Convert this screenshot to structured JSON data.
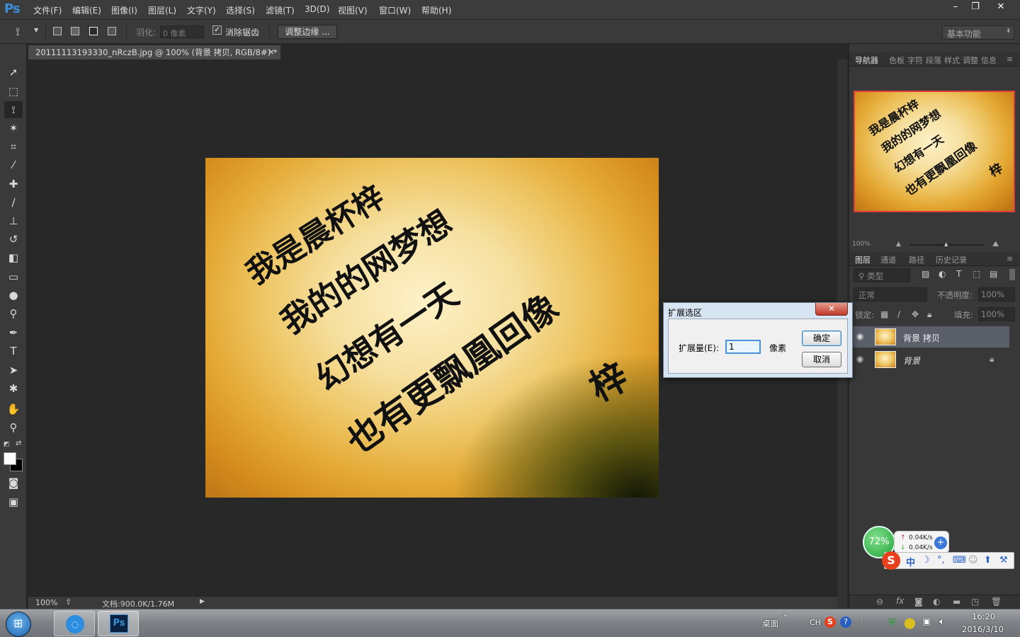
{
  "app": {
    "logo": "Ps"
  },
  "menu": [
    "文件(F)",
    "编辑(E)",
    "图像(I)",
    "图层(L)",
    "文字(Y)",
    "选择(S)",
    "滤镜(T)",
    "3D(D)",
    "视图(V)",
    "窗口(W)",
    "帮助(H)"
  ],
  "window_controls": {
    "minimize": "–",
    "restore": "❐",
    "close": "✕"
  },
  "options": {
    "feather_label": "羽化:",
    "feather_placeholder": "0 像素",
    "antialias_label": "消除锯齿",
    "antialias_checked": true,
    "refine_edge_label": "调整边缘 ...",
    "workspace": "基本功能"
  },
  "document": {
    "tab_title": "20111113193330_nRczB.jpg @ 100% (背景 拷贝, RGB/8#) *",
    "tab_close": "×",
    "handwriting_lines": [
      "我是晨杯梓",
      "我的的网梦想",
      "幻想有一天",
      "也有更飘凰回像",
      "梓"
    ]
  },
  "status": {
    "zoom": "100%",
    "doc_info": "文档:900.0K/1.76M"
  },
  "navigator": {
    "tabs": [
      "导航器",
      "色板",
      "字符",
      "段落",
      "样式",
      "调整",
      "信息"
    ],
    "zoom": "100%"
  },
  "layers_panel": {
    "tabs": [
      "图层",
      "通道",
      "路径",
      "历史记录"
    ],
    "filter_kind": "类型",
    "blend_mode": "正常",
    "opacity_label": "不透明度:",
    "opacity_value": "100%",
    "lock_label": "锁定:",
    "fill_label": "填充:",
    "fill_value": "100%",
    "layers": [
      {
        "name": "背景 拷贝",
        "selected": true,
        "locked": false
      },
      {
        "name": "背景",
        "selected": false,
        "locked": true
      }
    ]
  },
  "dialog": {
    "title": "扩展选区",
    "close": "✕",
    "expand_label": "扩展量(E):",
    "expand_value": "1",
    "unit": "像素",
    "ok": "确定",
    "cancel": "取消"
  },
  "widget": {
    "percent": "72%",
    "up_speed": "0.04K/s",
    "down_speed": "0.04K/s",
    "ime_lang": "中"
  },
  "taskbar": {
    "desktop_label": "桌面",
    "lang": "CH",
    "time": "16:20",
    "date": "2016/3/10"
  }
}
